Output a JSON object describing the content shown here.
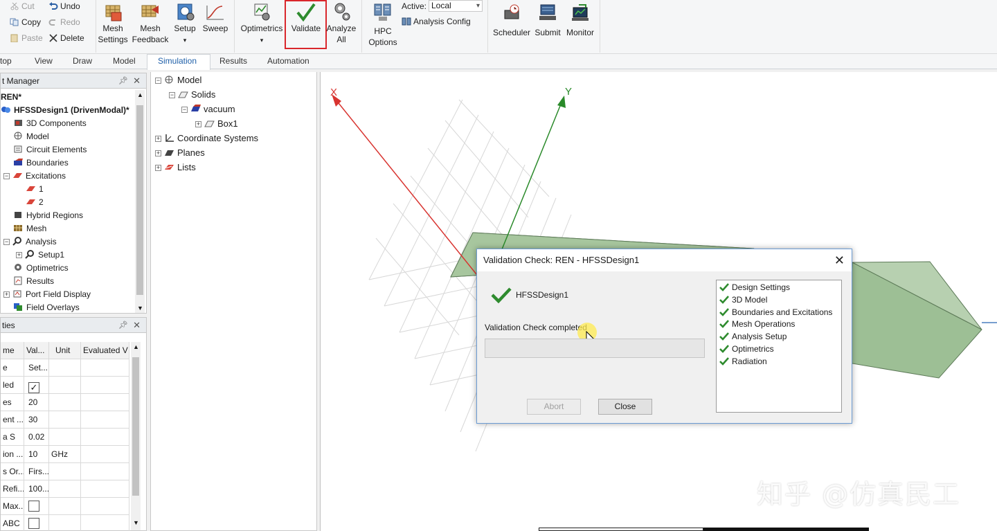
{
  "ribbon": {
    "clipboard": {
      "cut": "Cut",
      "copy": "Copy",
      "paste": "Paste",
      "undo": "Undo",
      "redo": "Redo",
      "delete": "Delete"
    },
    "mesh_settings": [
      "Mesh",
      "Settings"
    ],
    "mesh_feedback": [
      "Mesh",
      "Feedback"
    ],
    "setup": "Setup",
    "sweep": "Sweep",
    "optimetrics": "Optimetrics",
    "validate": "Validate",
    "analyze_all": [
      "Analyze",
      "All"
    ],
    "hpc_options": [
      "HPC",
      "Options"
    ],
    "active_label": "Active:",
    "active_value": "Local",
    "analysis_config": "Analysis Config",
    "scheduler": "Scheduler",
    "submit": "Submit",
    "monitor": "Monitor"
  },
  "tabs": [
    "top",
    "View",
    "Draw",
    "Model",
    "Simulation",
    "Results",
    "Automation"
  ],
  "selected_tab": "Simulation",
  "project_manager": {
    "title": "t Manager",
    "items": [
      {
        "label": "REN*"
      },
      {
        "label": "HFSSDesign1 (DrivenModal)*"
      },
      {
        "label": "3D Components"
      },
      {
        "label": "Model"
      },
      {
        "label": "Circuit Elements"
      },
      {
        "label": "Boundaries"
      },
      {
        "label": "Excitations"
      },
      {
        "label": "1"
      },
      {
        "label": "2"
      },
      {
        "label": "Hybrid Regions"
      },
      {
        "label": "Mesh"
      },
      {
        "label": "Analysis"
      },
      {
        "label": "Setup1"
      },
      {
        "label": "Optimetrics"
      },
      {
        "label": "Results"
      },
      {
        "label": "Port Field Display"
      },
      {
        "label": "Field Overlays"
      }
    ]
  },
  "properties": {
    "title": "ties",
    "headers": [
      "me",
      "Val...",
      "Unit",
      "Evaluated V"
    ],
    "rows": [
      {
        "name": "e",
        "value": "Set...",
        "unit": ""
      },
      {
        "name": "led",
        "value": "✓",
        "unit": ""
      },
      {
        "name": "es",
        "value": "20",
        "unit": ""
      },
      {
        "name": "ent ...",
        "value": "30",
        "unit": ""
      },
      {
        "name": "a S",
        "value": "0.02",
        "unit": ""
      },
      {
        "name": "ion ...",
        "value": "10",
        "unit": "GHz"
      },
      {
        "name": "s Or...",
        "value": "Firs...",
        "unit": ""
      },
      {
        "name": "Refi...",
        "value": "100...",
        "unit": ""
      },
      {
        "name": "Max...",
        "value": "",
        "unit": ""
      },
      {
        "name": "ABC",
        "value": "",
        "unit": ""
      }
    ]
  },
  "model_tree": {
    "items": [
      "Model",
      "Solids",
      "vacuum",
      "Box1",
      "Coordinate Systems",
      "Planes",
      "Lists"
    ]
  },
  "viewport": {
    "axis_x": "X",
    "axis_y": "Y"
  },
  "dialog": {
    "title": "Validation Check: REN - HFSSDesign1",
    "design_name": "HFSSDesign1",
    "status": "Validation Check completed",
    "abort": "Abort",
    "close": "Close",
    "checks": [
      "Design Settings",
      "3D Model",
      "Boundaries and Excitations",
      "Mesh Operations",
      "Analysis Setup",
      "Optimetrics",
      "Radiation"
    ]
  },
  "watermark": "知乎 @仿真民工",
  "colors": {
    "accent": "#1e5fa8",
    "check_green": "#2e8b2e",
    "axis_x": "#d8332f",
    "axis_y": "#2a8a2a",
    "box_fill": "#9dbf95",
    "highlight_red": "#d9262b"
  }
}
